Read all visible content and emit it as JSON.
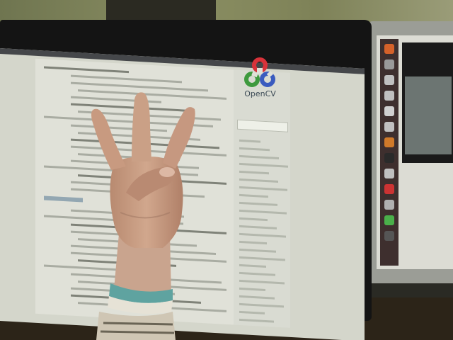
{
  "scene": {
    "description_tag": "photo",
    "logo_text": "OpenCV",
    "colors": {
      "logo_red": "#d8323a",
      "logo_green": "#3e9a3e",
      "logo_blue": "#3a5bbf",
      "skin": "#c89a80",
      "bracelet": "#5fa3a0"
    },
    "launcher_icons": [
      "#d6622a",
      "#9a9a9a",
      "#c0c0c0",
      "#c0c0c0",
      "#d0d0d0",
      "#c0c0c0",
      "#d07a2a",
      "#2a2a2a",
      "#c0c0c0",
      "#cc3333",
      "#b0b0b0",
      "#4ab04a",
      "#555555"
    ]
  }
}
